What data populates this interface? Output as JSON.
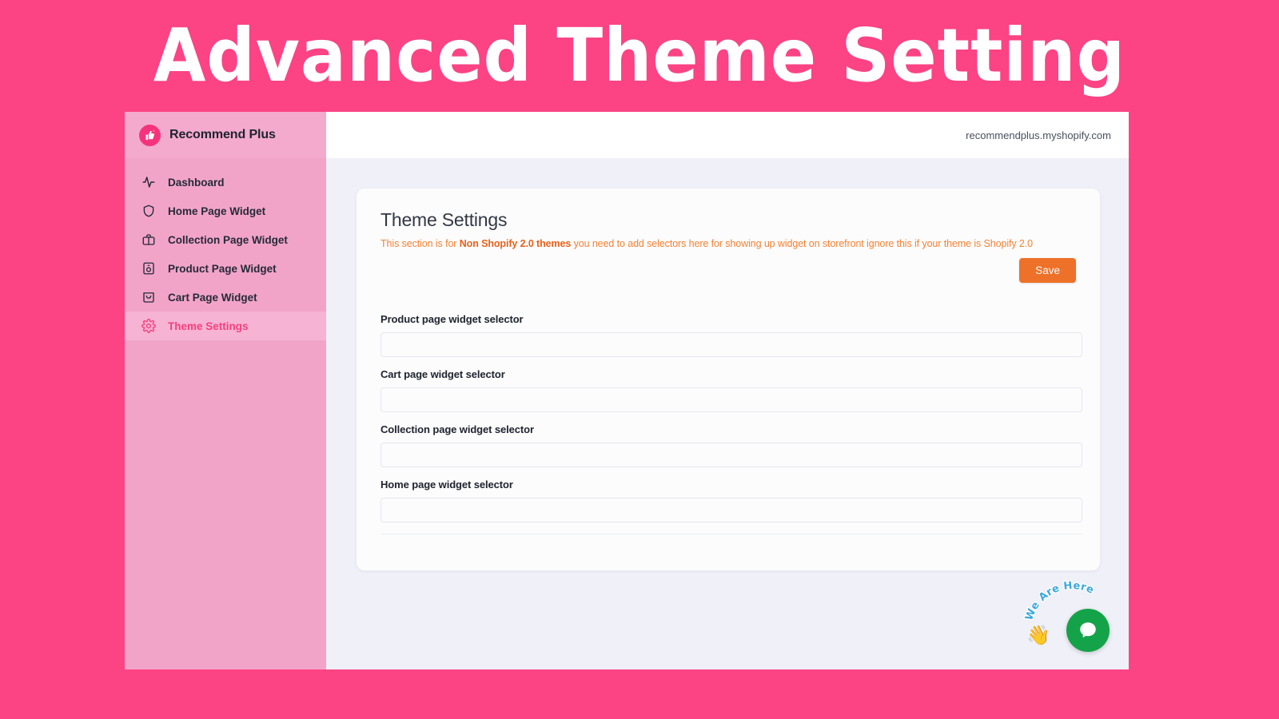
{
  "banner": {
    "title": "Advanced Theme Setting",
    "background_color": "#fc4384",
    "text_color": "#ffffff"
  },
  "sidebar": {
    "brand": "Recommend Plus",
    "logo_icon": "thumbs-up-plus-icon",
    "background_color": "#f2a4c8",
    "active_color": "#f5417f",
    "items": [
      {
        "label": "Dashboard",
        "icon": "activity-pulse-icon",
        "active": false
      },
      {
        "label": "Home Page Widget",
        "icon": "shield-icon",
        "active": false
      },
      {
        "label": "Collection Page Widget",
        "icon": "briefcase-icon",
        "active": false
      },
      {
        "label": "Product Page Widget",
        "icon": "product-box-icon",
        "active": false
      },
      {
        "label": "Cart Page Widget",
        "icon": "shopping-bag-icon",
        "active": false
      },
      {
        "label": "Theme Settings",
        "icon": "gear-icon",
        "active": true
      }
    ]
  },
  "topbar": {
    "store_url": "recommendplus.myshopify.com"
  },
  "card": {
    "title": "Theme Settings",
    "note_prefix": "This section is for ",
    "note_bold": "Non Shopify 2.0 themes",
    "note_suffix": " you need to add selectors here for showing up widget on storefront ignore this if your theme is Shopify 2.0",
    "note_color": "#f58233",
    "save_label": "Save",
    "save_color": "#ee7129",
    "fields": [
      {
        "label": "Product page widget selector",
        "value": "",
        "placeholder": ""
      },
      {
        "label": "Cart page widget selector",
        "value": "",
        "placeholder": ""
      },
      {
        "label": "Collection page widget selector",
        "value": "",
        "placeholder": ""
      },
      {
        "label": "Home page widget selector",
        "value": "",
        "placeholder": ""
      }
    ]
  },
  "chat": {
    "label": "We Are Here",
    "label_color": "#3ba9dd",
    "hand_icon": "waving-hand-icon",
    "bubble_icon": "chat-bubble-icon",
    "bubble_color": "#15a349"
  }
}
